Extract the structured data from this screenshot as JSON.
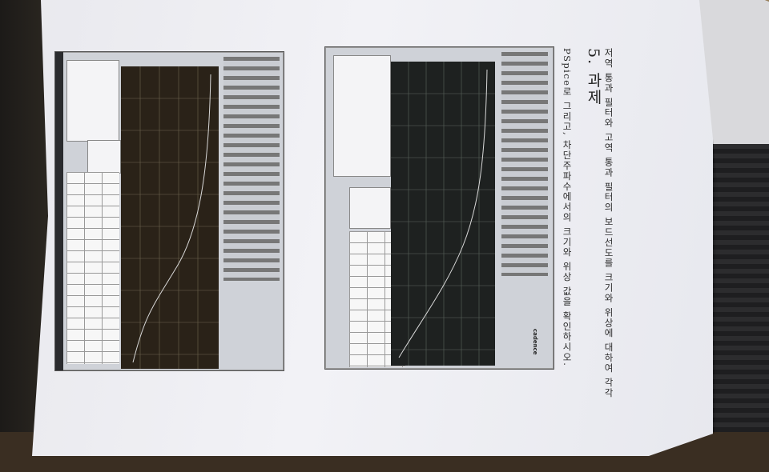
{
  "document": {
    "heading": "5. 과제",
    "lines": [
      "저역 통과 필터와 고역 통과 필터의 보드선도를 크기와 위상에 대하여 각각",
      "PSpice로 그리고, 차단주파수에서의 크기와 위상 값을 확인하시오."
    ],
    "logo_text": "cadence"
  },
  "colors": {
    "plot_bg_left": "#2a2218",
    "plot_bg_right": "#1c1f1e",
    "trace": "#cfcfcf",
    "grid": "#6a6a5a"
  }
}
